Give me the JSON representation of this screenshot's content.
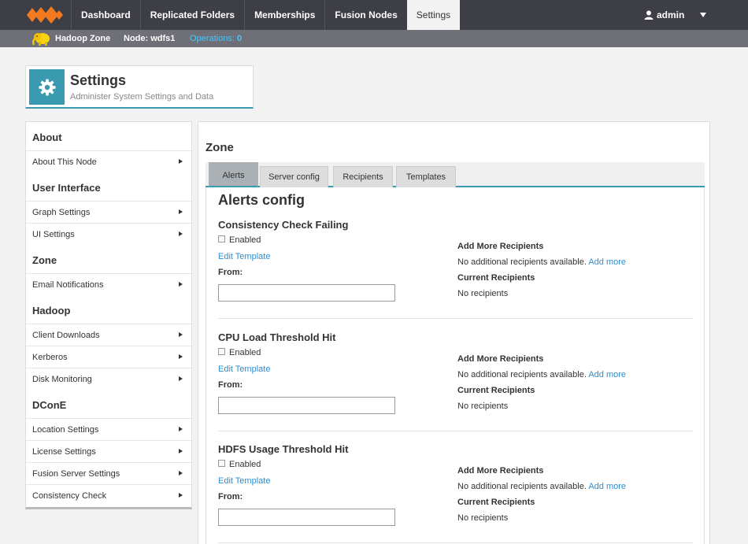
{
  "nav": {
    "links": [
      "Dashboard",
      "Replicated Folders",
      "Memberships",
      "Fusion Nodes",
      "Settings"
    ],
    "active": "Settings",
    "user": "admin",
    "brand_color": "#f47a20"
  },
  "subbar": {
    "zone": "Hadoop Zone",
    "node_prefix": "Node:",
    "node": "wdfs1",
    "ops_prefix": "Operations:",
    "ops": "0"
  },
  "header": {
    "title": "Settings",
    "subtitle": "Administer System Settings and Data",
    "accent": "#3a9bb0"
  },
  "menu": {
    "sections": [
      {
        "title": "About",
        "items": [
          "About This Node"
        ]
      },
      {
        "title": "User Interface",
        "items": [
          "Graph Settings",
          "UI Settings"
        ]
      },
      {
        "title": "Zone",
        "items": [
          "Email Notifications"
        ]
      },
      {
        "title": "Hadoop",
        "items": [
          "Client Downloads",
          "Kerberos",
          "Disk Monitoring"
        ]
      },
      {
        "title": "DConE",
        "items": [
          "Location Settings",
          "License Settings",
          "Fusion Server Settings",
          "Consistency Check"
        ]
      }
    ]
  },
  "main": {
    "title": "Zone",
    "tabs": [
      "Alerts",
      "Server config",
      "Recipients",
      "Templates"
    ],
    "active_tab": "Alerts",
    "alerts_title": "Alerts config",
    "labels": {
      "enabled": "Enabled",
      "edit_template": "Edit Template",
      "from": "From:",
      "add_more_heading": "Add More Recipients",
      "add_more_text": "No additional recipients available.",
      "add_more_link": "Add more",
      "current_heading": "Current Recipients",
      "current_text": "No recipients"
    },
    "alerts": [
      {
        "name": "Consistency Check Failing",
        "enabled": false,
        "from": ""
      },
      {
        "name": "CPU Load Threshold Hit",
        "enabled": false,
        "from": ""
      },
      {
        "name": "HDFS Usage Threshold Hit",
        "enabled": false,
        "from": ""
      }
    ]
  }
}
